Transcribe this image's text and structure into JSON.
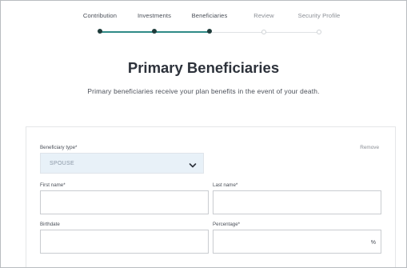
{
  "stepper": {
    "steps": [
      {
        "label": "Contribution",
        "state": "done"
      },
      {
        "label": "Investments",
        "state": "done"
      },
      {
        "label": "Beneficiaries",
        "state": "current"
      },
      {
        "label": "Review",
        "state": "pending"
      },
      {
        "label": "Security Profile",
        "state": "pending"
      }
    ]
  },
  "header": {
    "title": "Primary Beneficiaries",
    "subtitle": "Primary beneficiaries receive your plan benefits in the event of your death."
  },
  "form": {
    "beneficiary_type_label": "Beneficiary type*",
    "beneficiary_type_value": "SPOUSE",
    "remove_label": "Remove",
    "first_name_label": "First name*",
    "first_name_value": "",
    "last_name_label": "Last name*",
    "last_name_value": "",
    "birthdate_label": "Birthdate",
    "birthdate_value": "",
    "percentage_label": "Percentage*",
    "percentage_value": "",
    "percentage_suffix": "%"
  },
  "colors": {
    "accent": "#2f8b87",
    "step_dot_done": "#1f3c3b",
    "select_bg": "#e8f1f8"
  }
}
